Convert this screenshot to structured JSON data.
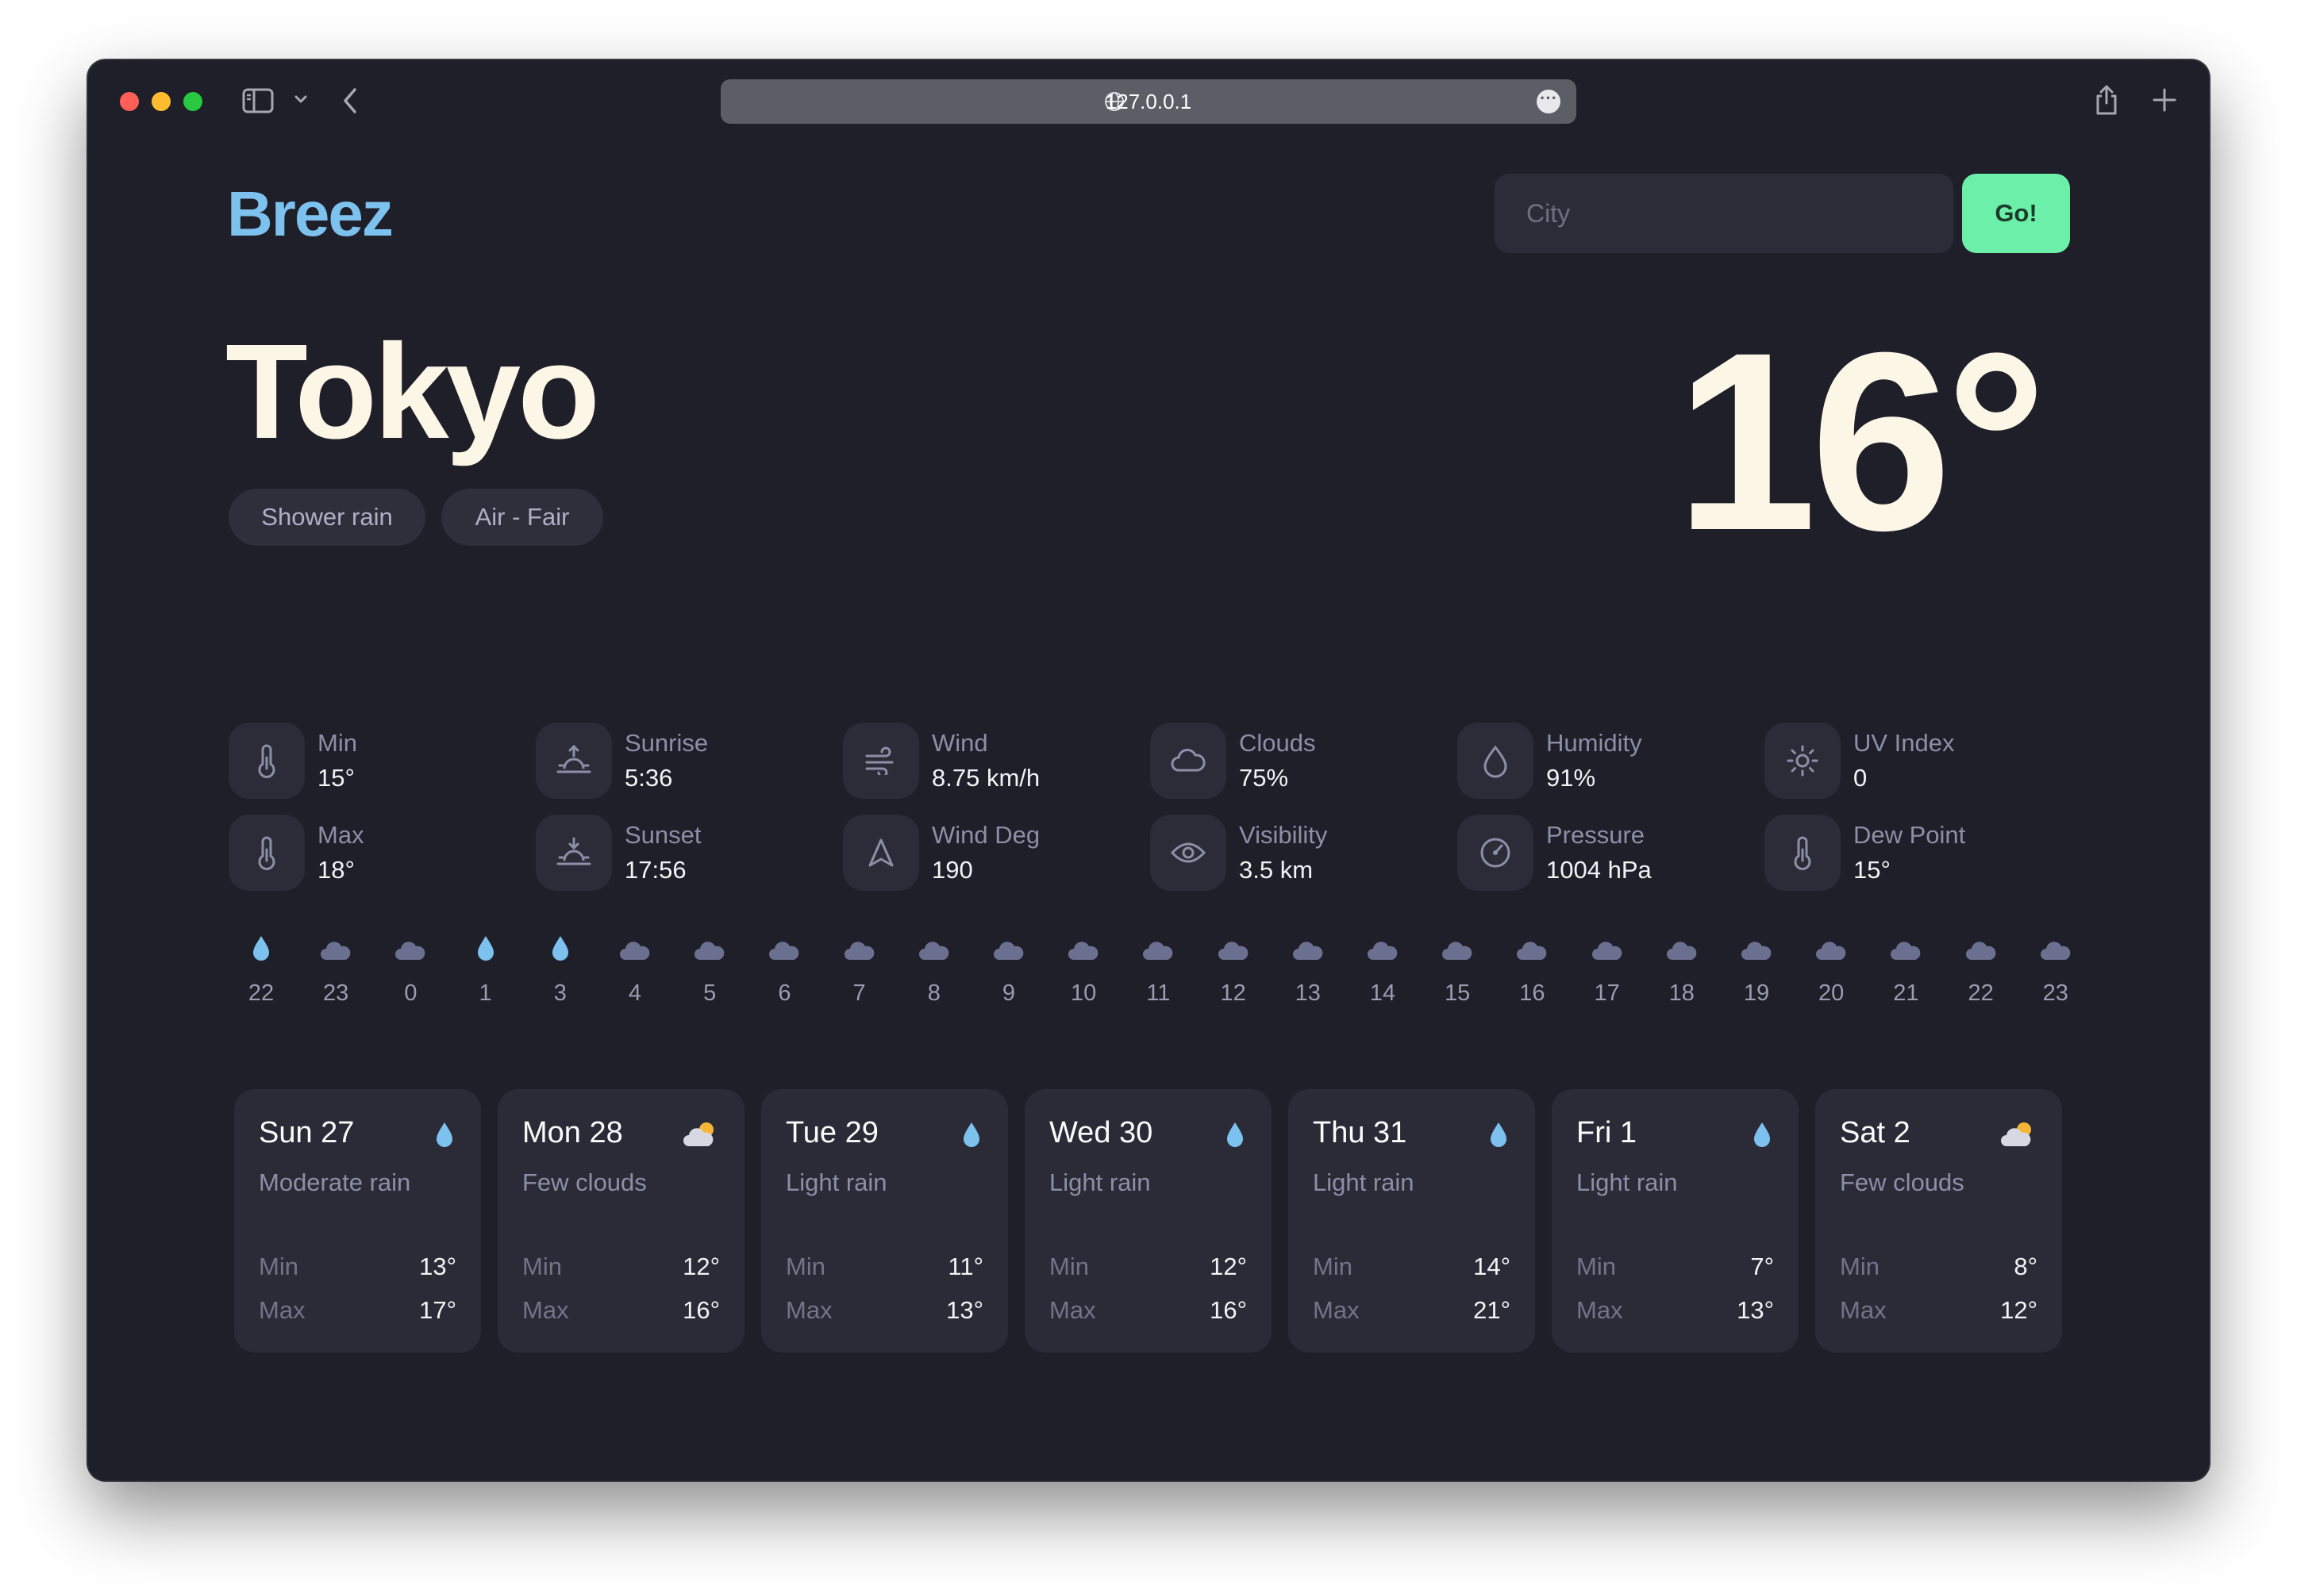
{
  "browser": {
    "url": "127.0.0.1"
  },
  "app": {
    "logo": "Breez",
    "search": {
      "placeholder": "City",
      "button_label": "Go!"
    }
  },
  "current": {
    "city": "Tokyo",
    "temperature": "16°",
    "tags": [
      "Shower rain",
      "Air - Fair"
    ]
  },
  "stats": [
    {
      "label": "Min",
      "value": "15°",
      "icon": "thermometer-icon"
    },
    {
      "label": "Max",
      "value": "18°",
      "icon": "thermometer-icon"
    },
    {
      "label": "Sunrise",
      "value": "5:36",
      "icon": "sunrise-icon"
    },
    {
      "label": "Sunset",
      "value": "17:56",
      "icon": "sunset-icon"
    },
    {
      "label": "Wind",
      "value": "8.75 km/h",
      "icon": "wind-icon"
    },
    {
      "label": "Wind Deg",
      "value": "190",
      "icon": "navigation-arrow-icon"
    },
    {
      "label": "Clouds",
      "value": "75%",
      "icon": "cloud-icon"
    },
    {
      "label": "Visibility",
      "value": "3.5 km",
      "icon": "eye-icon"
    },
    {
      "label": "Humidity",
      "value": "91%",
      "icon": "droplet-icon"
    },
    {
      "label": "Pressure",
      "value": "1004 hPa",
      "icon": "gauge-icon"
    },
    {
      "label": "UV Index",
      "value": "0",
      "icon": "sun-icon"
    },
    {
      "label": "Dew Point",
      "value": "15°",
      "icon": "thermometer-icon"
    }
  ],
  "hourly": [
    {
      "hour": "22",
      "icon": "rain-drop-icon"
    },
    {
      "hour": "23",
      "icon": "cloud-icon"
    },
    {
      "hour": "0",
      "icon": "cloud-icon"
    },
    {
      "hour": "1",
      "icon": "rain-drop-icon"
    },
    {
      "hour": "3",
      "icon": "rain-drop-icon"
    },
    {
      "hour": "4",
      "icon": "cloud-icon"
    },
    {
      "hour": "5",
      "icon": "cloud-icon"
    },
    {
      "hour": "6",
      "icon": "cloud-icon"
    },
    {
      "hour": "7",
      "icon": "cloud-icon"
    },
    {
      "hour": "8",
      "icon": "cloud-icon"
    },
    {
      "hour": "9",
      "icon": "cloud-icon"
    },
    {
      "hour": "10",
      "icon": "cloud-icon"
    },
    {
      "hour": "11",
      "icon": "cloud-icon"
    },
    {
      "hour": "12",
      "icon": "cloud-icon"
    },
    {
      "hour": "13",
      "icon": "cloud-icon"
    },
    {
      "hour": "14",
      "icon": "cloud-icon"
    },
    {
      "hour": "15",
      "icon": "cloud-icon"
    },
    {
      "hour": "16",
      "icon": "cloud-icon"
    },
    {
      "hour": "17",
      "icon": "cloud-icon"
    },
    {
      "hour": "18",
      "icon": "cloud-icon"
    },
    {
      "hour": "19",
      "icon": "cloud-icon"
    },
    {
      "hour": "20",
      "icon": "cloud-icon"
    },
    {
      "hour": "21",
      "icon": "cloud-icon"
    },
    {
      "hour": "22",
      "icon": "cloud-icon"
    },
    {
      "hour": "23",
      "icon": "cloud-icon"
    }
  ],
  "daily": [
    {
      "day": "Sun 27",
      "desc": "Moderate rain",
      "icon": "rain-drop-icon",
      "min_label": "Min",
      "min": "13°",
      "max_label": "Max",
      "max": "17°"
    },
    {
      "day": "Mon 28",
      "desc": "Few clouds",
      "icon": "sun-cloud-icon",
      "min_label": "Min",
      "min": "12°",
      "max_label": "Max",
      "max": "16°"
    },
    {
      "day": "Tue 29",
      "desc": "Light rain",
      "icon": "rain-drop-icon",
      "min_label": "Min",
      "min": "11°",
      "max_label": "Max",
      "max": "13°"
    },
    {
      "day": "Wed 30",
      "desc": "Light rain",
      "icon": "rain-drop-icon",
      "min_label": "Min",
      "min": "12°",
      "max_label": "Max",
      "max": "16°"
    },
    {
      "day": "Thu 31",
      "desc": "Light rain",
      "icon": "rain-drop-icon",
      "min_label": "Min",
      "min": "14°",
      "max_label": "Max",
      "max": "21°"
    },
    {
      "day": "Fri 1",
      "desc": "Light rain",
      "icon": "rain-drop-icon",
      "min_label": "Min",
      "min": "7°",
      "max_label": "Max",
      "max": "13°"
    },
    {
      "day": "Sat 2",
      "desc": "Few clouds",
      "icon": "sun-cloud-icon",
      "min_label": "Min",
      "min": "8°",
      "max_label": "Max",
      "max": "12°"
    }
  ],
  "colors": {
    "accent": "#7dc1ee",
    "go_button": "#6cf0a9",
    "background": "#1f1f29",
    "card": "#2b2b38",
    "text": "#fbf6e6",
    "rain": "#7dc1ee",
    "cloud": "#6b7090"
  }
}
